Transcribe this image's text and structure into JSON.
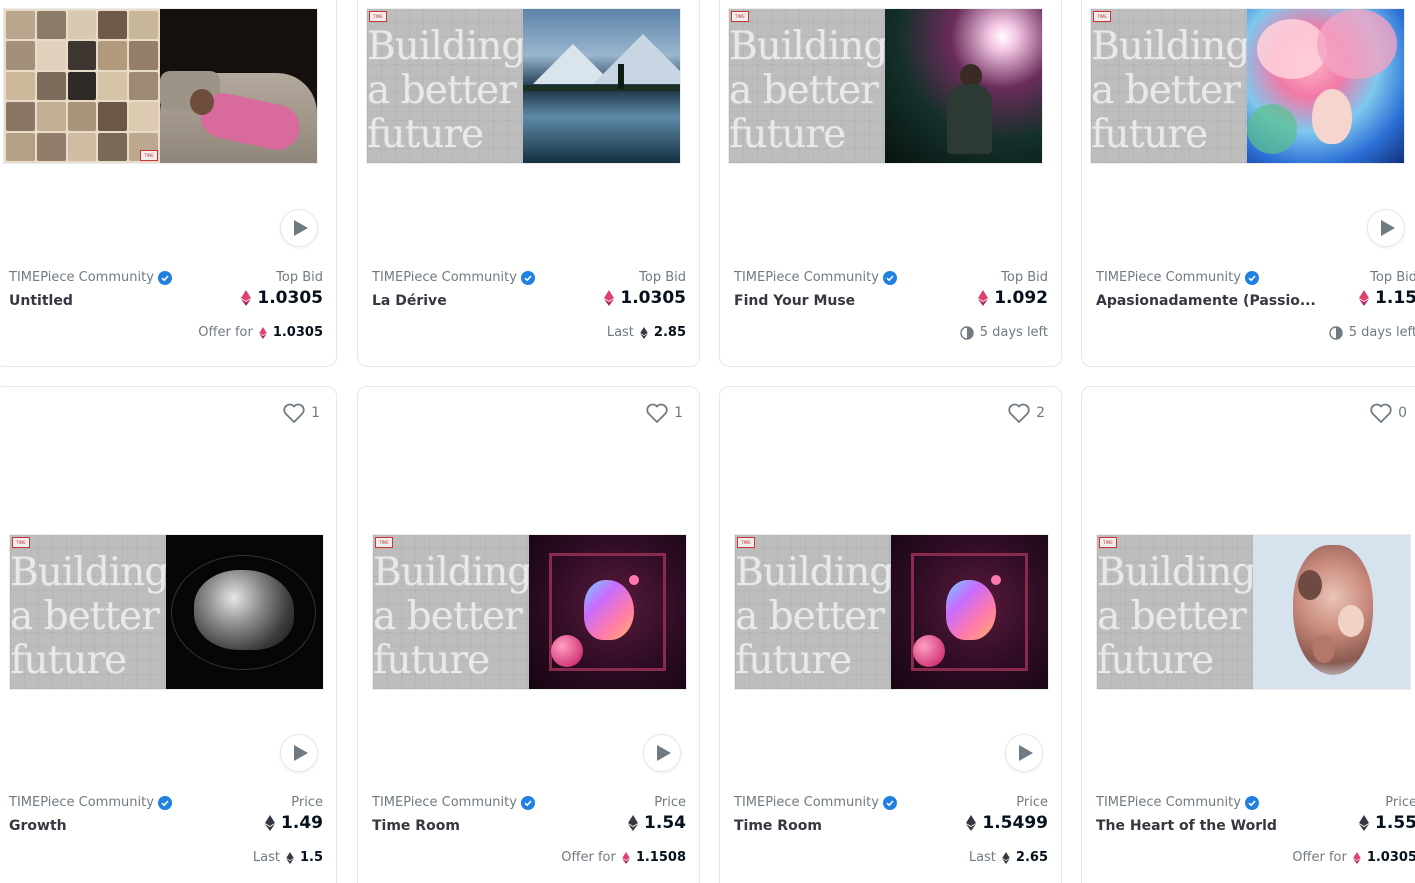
{
  "colors": {
    "eth_pink": "#e0426c",
    "eth_dark": "#353840",
    "verified": "#2081e2"
  },
  "art_text": [
    "Building",
    "a better",
    "future"
  ],
  "art_tag": "TIME",
  "cards_row1": [
    {
      "collection": "TIMEPiece Community",
      "title": "Untitled",
      "price_label": "Top Bid",
      "price": "1.0305",
      "price_eth": "pink",
      "footer_label": "Offer for",
      "footer_value": "1.0305",
      "footer_icon": "eth-pink",
      "art": "portrait-collage"
    },
    {
      "collection": "TIMEPiece Community",
      "title": "La Dérive",
      "price_label": "Top Bid",
      "price": "1.0305",
      "price_eth": "pink",
      "footer_label": "Last",
      "footer_value": "2.85",
      "footer_icon": "eth-dark",
      "art": "mountain-lake"
    },
    {
      "collection": "TIMEPiece Community",
      "title": "Find Your Muse",
      "price_label": "Top Bid",
      "price": "1.092",
      "price_eth": "pink",
      "footer_label": "5 days left",
      "footer_value": "",
      "footer_icon": "clock",
      "art": "stage-spotlight"
    },
    {
      "collection": "TIMEPiece Community",
      "title": "Apasionadamente (Passio...",
      "price_label": "Top Bid",
      "price": "1.15",
      "price_eth": "pink",
      "footer_label": "5 days left",
      "footer_value": "",
      "footer_icon": "clock",
      "art": "flower-face"
    }
  ],
  "cards_row2": [
    {
      "likes": "1",
      "collection": "TIMEPiece Community",
      "title": "Growth",
      "price_label": "Price",
      "price": "1.49",
      "price_eth": "dark",
      "footer_label": "Last",
      "footer_value": "1.5",
      "footer_icon": "eth-dark",
      "art": "glass-brain"
    },
    {
      "likes": "1",
      "collection": "TIMEPiece Community",
      "title": "Time Room",
      "price_label": "Price",
      "price": "1.54",
      "price_eth": "dark",
      "footer_label": "Offer for",
      "footer_value": "1.1508",
      "footer_icon": "eth-pink",
      "art": "purple-room"
    },
    {
      "likes": "2",
      "collection": "TIMEPiece Community",
      "title": "Time Room",
      "price_label": "Price",
      "price": "1.5499",
      "price_eth": "dark",
      "footer_label": "Last",
      "footer_value": "2.65",
      "footer_icon": "eth-dark",
      "art": "purple-room"
    },
    {
      "likes": "0",
      "collection": "TIMEPiece Community",
      "title": "The Heart of the World",
      "price_label": "Price",
      "price": "1.55",
      "price_eth": "dark",
      "footer_label": "Offer for",
      "footer_value": "1.0305",
      "footer_icon": "eth-pink",
      "art": "faces-heart"
    }
  ]
}
